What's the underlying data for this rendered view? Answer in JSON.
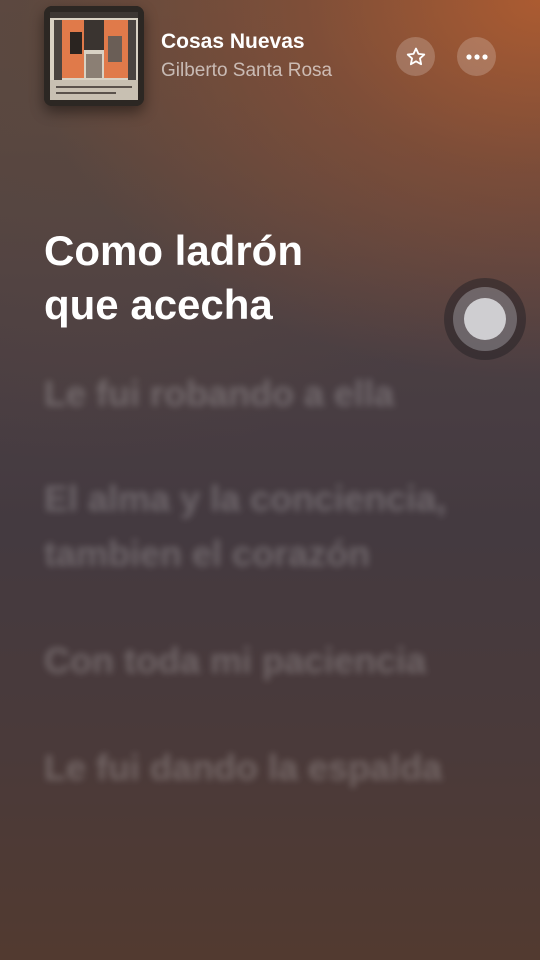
{
  "now_playing": {
    "title": "Cosas Nuevas",
    "artist": "Gilberto Santa Rosa",
    "album_art_icon": "album-cover-artwork"
  },
  "actions": {
    "favorite_icon": "star-icon",
    "more_icon": "ellipsis-icon"
  },
  "lyrics": {
    "active": [
      "Como ladrón",
      "que acecha"
    ],
    "upcoming": [
      "Le fui robando a ella",
      "El alma y la conciencia, tambien el corazón",
      "Con toda mi paciencia",
      "Le fui dando la espalda"
    ]
  },
  "colors": {
    "accent_top_right": "#b05c30",
    "background_mid": "#443a40",
    "active_text": "#ffffff"
  }
}
